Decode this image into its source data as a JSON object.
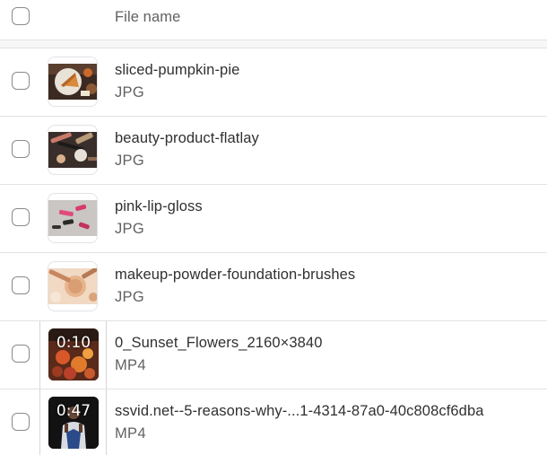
{
  "header": {
    "column_file_name": "File name"
  },
  "files": [
    {
      "name": "sliced-pumpkin-pie",
      "type": "JPG",
      "thumb_icon": "pumpkin-pie-photo"
    },
    {
      "name": "beauty-product-flatlay",
      "type": "JPG",
      "thumb_icon": "beauty-flatlay-photo"
    },
    {
      "name": "pink-lip-gloss",
      "type": "JPG",
      "thumb_icon": "lip-gloss-photo"
    },
    {
      "name": "makeup-powder-foundation-brushes",
      "type": "JPG",
      "thumb_icon": "makeup-brushes-photo"
    },
    {
      "name": "0_Sunset_Flowers_2160×3840",
      "type": "MP4",
      "duration": "0:10",
      "thumb_icon": "sunset-flowers-video"
    },
    {
      "name": "ssvid.net--5-reasons-why-...1-4314-87a0-40c808cf6dba",
      "type": "MP4",
      "duration": "0:47",
      "thumb_icon": "person-video"
    }
  ]
}
